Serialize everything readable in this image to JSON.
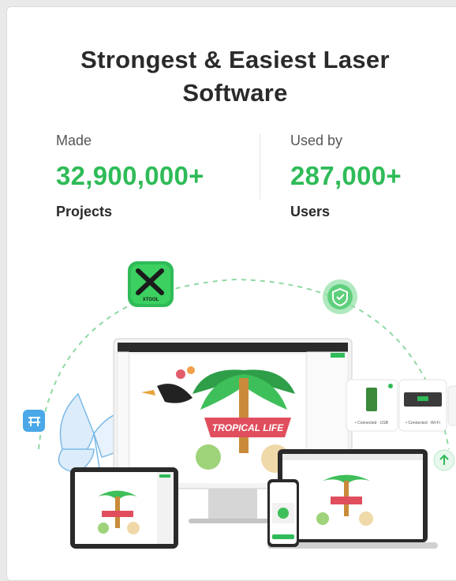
{
  "header": {
    "title_line1": "Strongest & Easiest Laser",
    "title_line2": "Software"
  },
  "stats": [
    {
      "label": "Made",
      "value": "32,900,000+",
      "unit": "Projects"
    },
    {
      "label": "Used by",
      "value": "287,000+",
      "unit": "Users"
    }
  ],
  "illustration": {
    "app_icon_text": "XTOOL",
    "banner_text": "TROPICAL LIFE",
    "device_cards": [
      {
        "status": "• Connected · USB"
      },
      {
        "status": "• Connected · Wi-Fi"
      }
    ]
  },
  "colors": {
    "accent": "#2fbb58",
    "title": "#2a2a2a"
  }
}
